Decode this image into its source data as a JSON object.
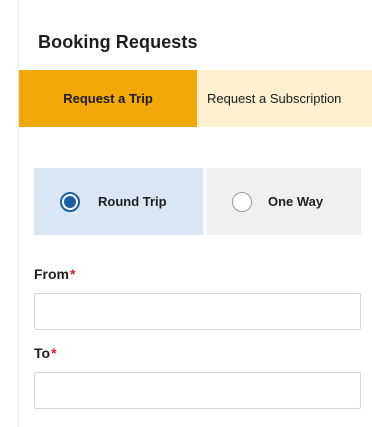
{
  "page_title": "Booking Requests",
  "tabs": [
    {
      "label": "Request a Trip",
      "active": true
    },
    {
      "label": "Request a Subscription",
      "active": false
    }
  ],
  "trip_types": [
    {
      "label": "Round Trip",
      "selected": true
    },
    {
      "label": "One Way",
      "selected": false
    }
  ],
  "form": {
    "from": {
      "label": "From",
      "required_mark": "*",
      "value": "",
      "placeholder": ""
    },
    "to": {
      "label": "To",
      "required_mark": "*",
      "value": "",
      "placeholder": ""
    }
  },
  "colors": {
    "tab_active_bg": "#f0a806",
    "tab_inactive_bg": "#fdf0cf",
    "selected_option_bg": "#d9e7f4",
    "unselected_option_bg": "#eff0f0",
    "radio_accent": "#1b5fa8",
    "required_mark": "#d1202e"
  }
}
